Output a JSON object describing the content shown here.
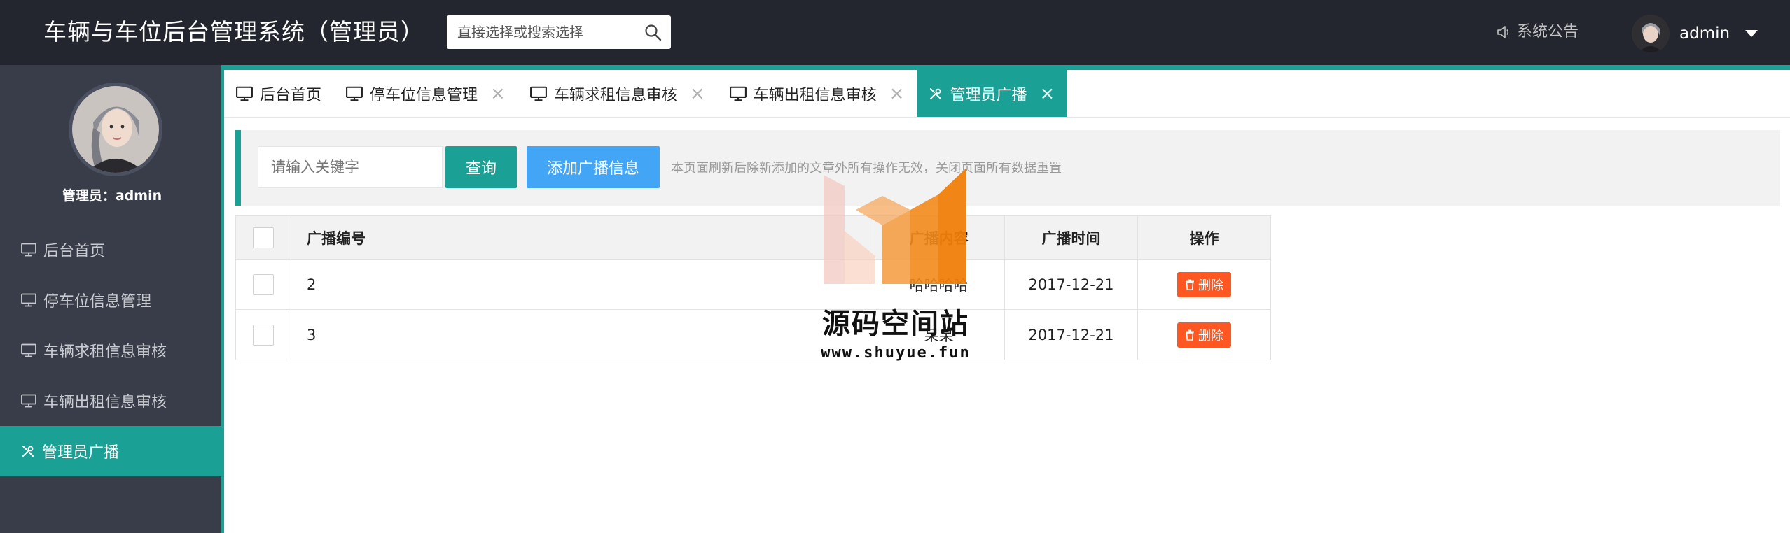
{
  "header": {
    "title": "车辆与车位后台管理系统（管理员）",
    "search_placeholder": "直接选择或搜索选择",
    "notice_label": "系统公告",
    "username": "admin"
  },
  "sidebar": {
    "admin_label": "管理员：admin",
    "items": [
      {
        "label": "后台首页",
        "icon": "monitor-icon",
        "active": false
      },
      {
        "label": "停车位信息管理",
        "icon": "monitor-icon",
        "active": false
      },
      {
        "label": "车辆求租信息审核",
        "icon": "monitor-icon",
        "active": false
      },
      {
        "label": "车辆出租信息审核",
        "icon": "monitor-icon",
        "active": false
      },
      {
        "label": "管理员广播",
        "icon": "tools-icon",
        "active": true
      }
    ]
  },
  "tabs": [
    {
      "label": "后台首页",
      "closable": false,
      "active": false
    },
    {
      "label": "停车位信息管理",
      "closable": true,
      "active": false
    },
    {
      "label": "车辆求租信息审核",
      "closable": true,
      "active": false
    },
    {
      "label": "车辆出租信息审核",
      "closable": true,
      "active": false
    },
    {
      "label": "管理员广播",
      "closable": true,
      "active": true
    }
  ],
  "toolbar": {
    "keyword_placeholder": "请输入关键字",
    "query_label": "查询",
    "add_label": "添加广播信息",
    "tip": "本页面刷新后除新添加的文章外所有操作无效，关闭页面所有数据重置"
  },
  "table": {
    "columns": [
      "广播编号",
      "广播内容",
      "广播时间",
      "操作"
    ],
    "rows": [
      {
        "id": "2",
        "content": "哈哈哈哈",
        "time": "2017-12-21",
        "action": "删除"
      },
      {
        "id": "3",
        "content": "呆呆",
        "time": "2017-12-21",
        "action": "删除"
      }
    ]
  },
  "watermark": {
    "title": "源码空间站",
    "url": "www.shuyue.fun"
  },
  "colors": {
    "topbar": "#23262e",
    "sidebar": "#393d49",
    "accent": "#1aa094",
    "add_button": "#42a5f5",
    "delete_button": "#ff5722"
  }
}
